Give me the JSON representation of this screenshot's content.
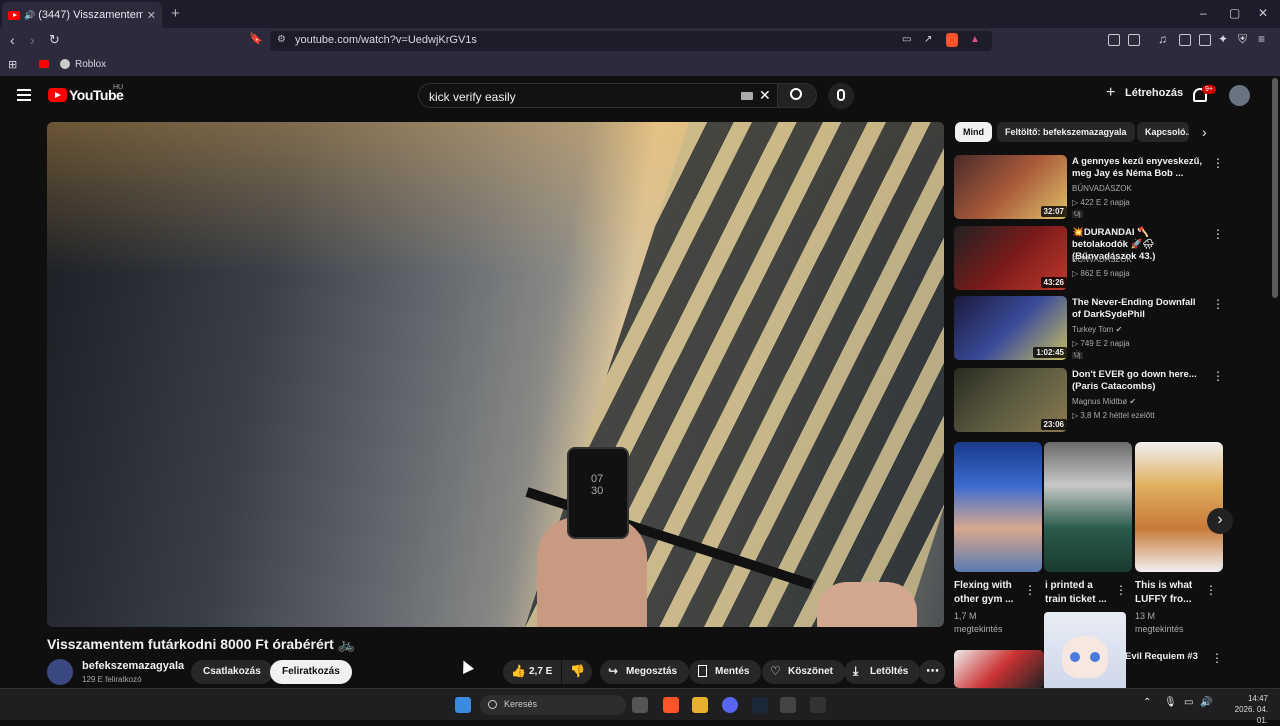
{
  "browser": {
    "tab_title": "(3447) Visszamentem futárk...",
    "new_tab": "+",
    "url": "youtube.com/watch?v=UedwjKrGV1s",
    "bookmark": "Roblox",
    "win_min": "–",
    "win_max": "▢",
    "win_close": "✕"
  },
  "youtube": {
    "logo_text": "YouTube",
    "country": "HU",
    "search_value": "kick verify easily",
    "create_label": "Létrehozás",
    "notif_badge": "9+"
  },
  "video": {
    "phone_time": "07\n30",
    "title": "Visszamentem futárkodni 8000 Ft órabérért 🚲",
    "channel": "befekszemazagyala",
    "subscribers": "129 E feliratkozó",
    "join_label": "Csatlakozás",
    "subscribe_label": "Feliratkozás",
    "likes": "2,7 E",
    "share_label": "Megosztás",
    "save_label": "Mentés",
    "thanks_label": "Köszönet",
    "download_label": "Letöltés"
  },
  "chips": [
    "Mind",
    "Feltöltő: befekszemazagyala",
    "Kapcsoló..."
  ],
  "recommendations": [
    {
      "title": "A gennyes kezű enyveskezű, meg Jay és Néma Bob ...",
      "channel": "BŰNVADÁSZOK",
      "meta": "▷ 422 E  2 napja",
      "duration": "32:07",
      "new": "Új"
    },
    {
      "title": "💥DURANDAI 🪓 betolakodók 🚀🌧 (Bűnvadászok 43.)",
      "channel": "BŰNVADÁSZOK",
      "meta": "▷ 862 E  9 napja",
      "duration": "43:26",
      "new": ""
    },
    {
      "title": "The Never-Ending Downfall of DarkSydePhil",
      "channel": "Turkey Tom ✔",
      "meta": "▷ 749 E  2 napja",
      "duration": "1:02:45",
      "new": "Új"
    },
    {
      "title": "Don't EVER go down here... (Paris Catacombs)",
      "channel": "Magnus Midtbø ✔",
      "meta": "▷ 3,8 M  2 héttel ezelőtt",
      "duration": "23:06",
      "new": ""
    }
  ],
  "shorts": [
    {
      "title": "Flexing with other gym ...",
      "views": "1,7 M",
      "views_label": "megtekintés"
    },
    {
      "title": "i printed a train ticket ...",
      "views": "",
      "views_label": ""
    },
    {
      "title": "This is what LUFFY fro...",
      "views": "13 M",
      "views_label": "megtekintés"
    }
  ],
  "next_rec_title": "Evil Requiem #3",
  "taskbar": {
    "search_placeholder": "Keresés",
    "time": "14:47",
    "date": "2026. 04. 01."
  }
}
